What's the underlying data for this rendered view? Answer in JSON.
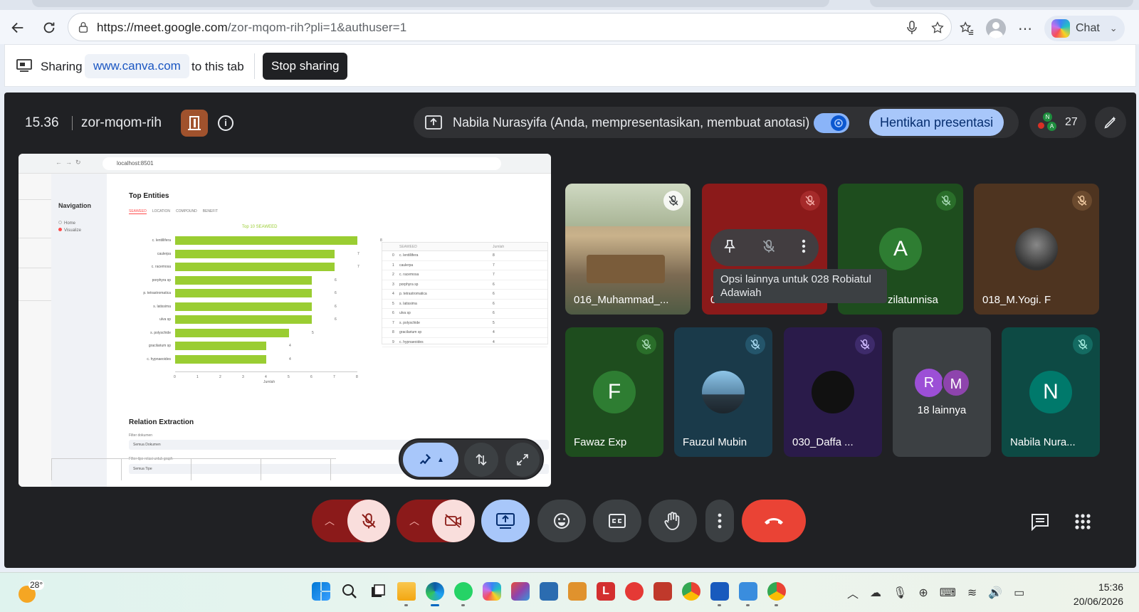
{
  "browser": {
    "url_host": "https://meet.google.com",
    "url_path": "/zor-mqom-rih?pli=1&authuser=1",
    "chat_label": "Chat"
  },
  "sharebar": {
    "sharing": "Sharing",
    "domain": "www.canva.com",
    "to_this_tab": "to this tab",
    "stop_sharing": "Stop sharing"
  },
  "meet": {
    "time": "15.36",
    "code": "zor-mqom-rih",
    "presenting_text": "Nabila Nurasyifa (Anda, mempresentasikan, membuat anotasi)",
    "stop_presenting": "Hentikan presentasi",
    "participant_count": "27",
    "tooltip": "Opsi lainnya untuk 028 Robiatul Adawiah",
    "tiles": [
      {
        "name": "016_Muhammad_...",
        "initial": ""
      },
      {
        "name": "0",
        "initial": ""
      },
      {
        "name": "zilatunnisa",
        "initial": "A"
      },
      {
        "name": "018_M.Yogi. F",
        "initial": ""
      },
      {
        "name": "Fawaz Exp",
        "initial": "F"
      },
      {
        "name": "Fauzul Mubin",
        "initial": ""
      },
      {
        "name": "030_Daffa ...",
        "initial": ""
      },
      {
        "name": "18 lainnya",
        "initial": ""
      },
      {
        "name": "Nabila Nura...",
        "initial": "N"
      }
    ],
    "others_initials": [
      "R",
      "M"
    ],
    "people_badges": [
      "N",
      "A"
    ]
  },
  "shared_screen": {
    "url": "localhost:8501",
    "nav_title": "Navigation",
    "nav_items": [
      "Home",
      "Visualize"
    ],
    "heading": "Top Entities",
    "tabs": [
      "SEAWEED",
      "LOCATION",
      "COMPOUND",
      "BENEFIT"
    ],
    "chart_title": "Top 10 SEAWEED",
    "relation_heading": "Relation Extraction",
    "filter1_label": "Filter dokumen",
    "filter1_value": "Semua Dokumen",
    "filter2_label": "Filter tipe relasi untuk graph",
    "filter2_value": "Semua Tipe",
    "table_headers": [
      "",
      "SEAWEED",
      "Jumlah"
    ]
  },
  "chart_data": {
    "type": "bar",
    "orientation": "horizontal",
    "title": "Top 10 SEAWEED",
    "xlabel": "Jumlah",
    "ylabel": "",
    "categories": [
      "c. lentillifera",
      "caulerpa",
      "c. racemosa",
      "porphyra sp",
      "p. tetrastromatica",
      "s. latissima",
      "ulva sp",
      "s. polyschide",
      "gracilarium sp",
      "c. hypnaeoides"
    ],
    "values": [
      8,
      7,
      7,
      6,
      6,
      6,
      6,
      5,
      4,
      4
    ],
    "xlim": [
      0,
      8
    ],
    "xticks": [
      "0",
      "1",
      "2",
      "3",
      "4",
      "5",
      "6",
      "7",
      "8"
    ]
  },
  "taskbar": {
    "temperature": "28°",
    "time": "15:36",
    "date": "20/06/2026"
  },
  "colors": {
    "meet_bg": "#202124",
    "accent_blue": "#a8c7fa",
    "danger": "#ea4335",
    "bar": "#9acd32"
  }
}
